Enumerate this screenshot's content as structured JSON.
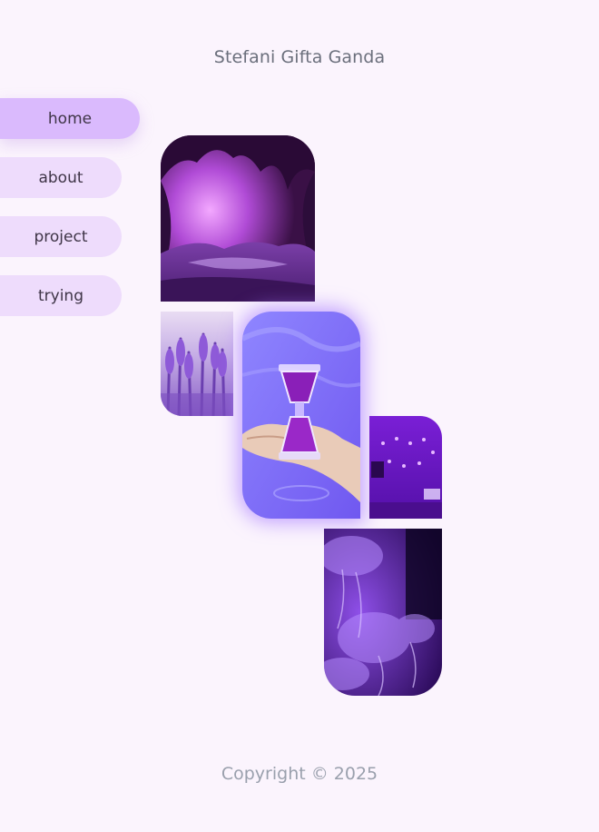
{
  "header": {
    "site_title": "Stefani Gifta Ganda"
  },
  "nav": {
    "items": [
      {
        "label": "home",
        "active": true
      },
      {
        "label": "about",
        "active": false
      },
      {
        "label": "project",
        "active": false
      },
      {
        "label": "trying",
        "active": false
      }
    ]
  },
  "gallery": {
    "images": [
      {
        "name": "purple cave"
      },
      {
        "name": "lavender field"
      },
      {
        "name": "hourglass in hand"
      },
      {
        "name": "purple lit room"
      },
      {
        "name": "jellyfish"
      }
    ]
  },
  "footer": {
    "copyright": "Copyright © 2025"
  },
  "colors": {
    "background": "#fbf4fd",
    "nav_active": "#dabafd",
    "nav_inactive": "#eedcfc",
    "accent_glow": "#a77bff"
  }
}
